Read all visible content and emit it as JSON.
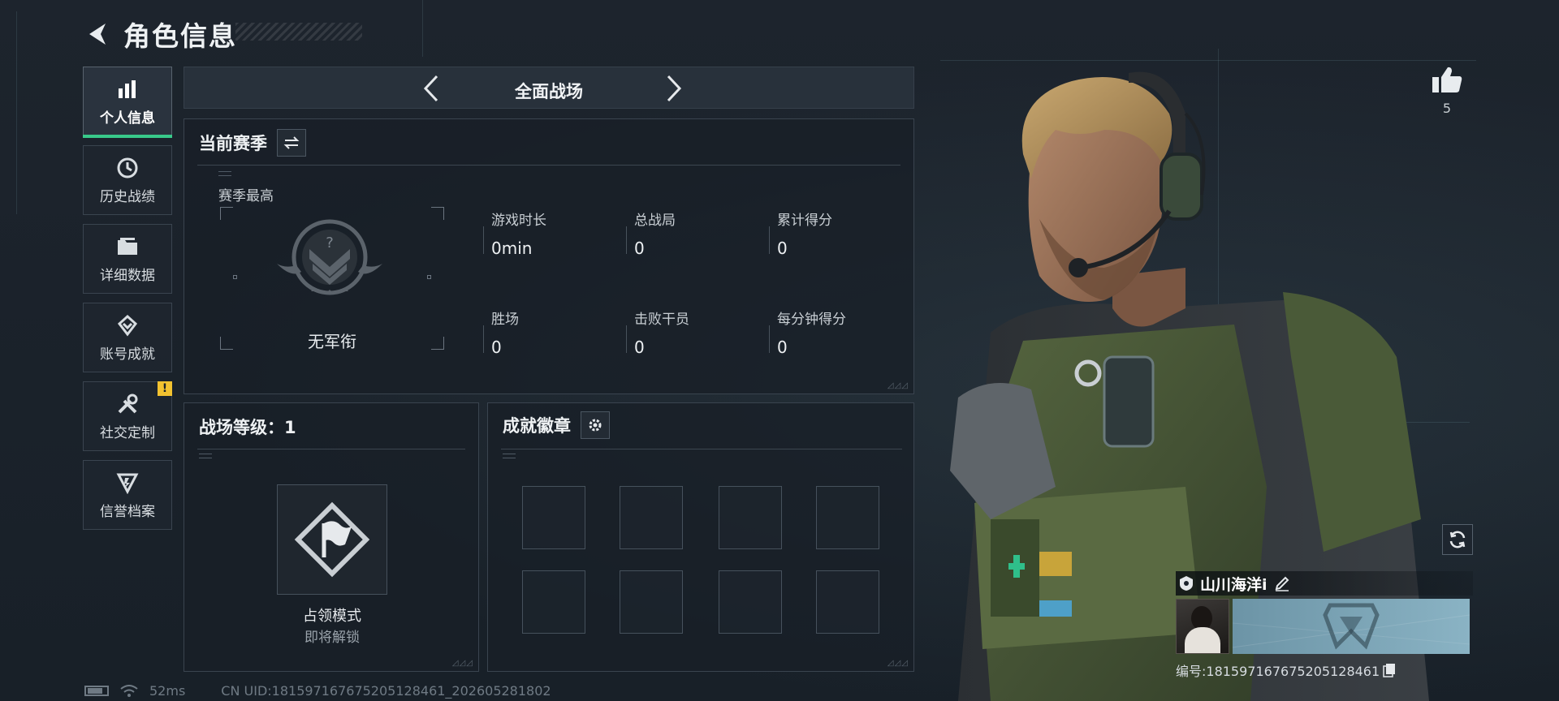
{
  "header": {
    "title": "角色信息"
  },
  "sidebar": {
    "items": [
      {
        "label": "个人信息",
        "icon": "bar-chart-icon"
      },
      {
        "label": "历史战绩",
        "icon": "clock-icon"
      },
      {
        "label": "详细数据",
        "icon": "folder-icon"
      },
      {
        "label": "账号成就",
        "icon": "achievement-icon"
      },
      {
        "label": "社交定制",
        "icon": "tools-icon"
      },
      {
        "label": "信誉档案",
        "icon": "shield-icon"
      }
    ],
    "alert_badge": "!"
  },
  "mode_nav": {
    "title": "全面战场"
  },
  "season": {
    "title": "当前赛季",
    "best_label": "赛季最高",
    "rank_label": "无军衔",
    "rank_question": "?",
    "stats": [
      {
        "label": "游戏时长",
        "value": "0min"
      },
      {
        "label": "总战局",
        "value": "0"
      },
      {
        "label": "累计得分",
        "value": "0"
      },
      {
        "label": "胜场",
        "value": "0"
      },
      {
        "label": "击败干员",
        "value": "0"
      },
      {
        "label": "每分钟得分",
        "value": "0"
      }
    ]
  },
  "battle_level": {
    "title": "战场等级：1",
    "mode_name": "占领模式",
    "mode_status": "即将解锁"
  },
  "achievements": {
    "title": "成就徽章"
  },
  "likes": {
    "count": "5"
  },
  "player": {
    "name": "山川海洋i",
    "id_text": "编号:1815971676752051284​61"
  },
  "footer": {
    "ping": "52ms",
    "uid": "CN UID:1815971676752051284​61_202605281802"
  },
  "colors": {
    "accent": "#38c98a",
    "alert": "#f2c230",
    "background": "#1b222b"
  }
}
